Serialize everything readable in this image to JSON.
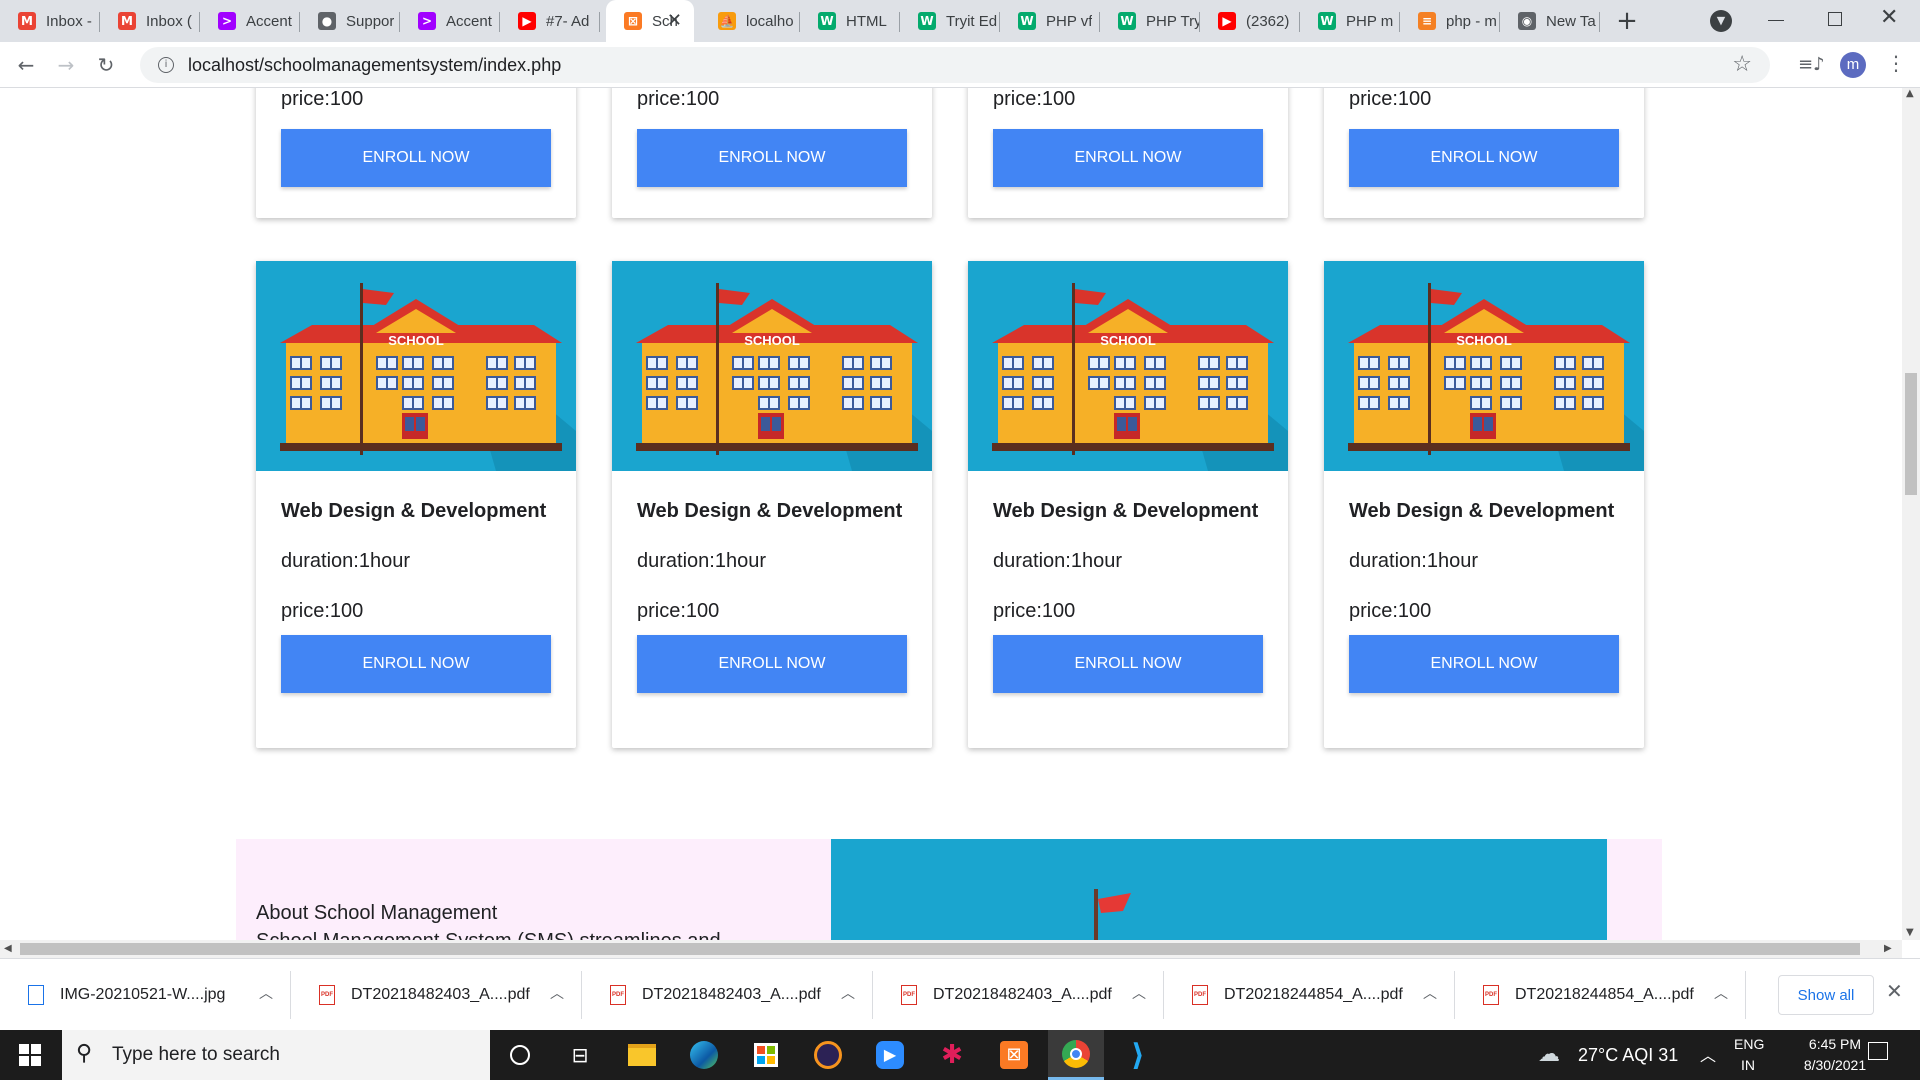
{
  "browser": {
    "tabs": [
      {
        "label": "Inbox -",
        "icon": "gmail-icon",
        "color": "#ea4335",
        "glyph": "M"
      },
      {
        "label": "Inbox (",
        "icon": "gmail-icon",
        "color": "#ea4335",
        "glyph": "M"
      },
      {
        "label": "Accent",
        "icon": "accenture-icon",
        "color": "#a100ff",
        "glyph": ">"
      },
      {
        "label": "Suppor",
        "icon": "globe-icon",
        "color": "#5f6368",
        "glyph": "●"
      },
      {
        "label": "Accent",
        "icon": "accenture-icon",
        "color": "#a100ff",
        "glyph": ">"
      },
      {
        "label": "#7- Ad",
        "icon": "youtube-icon",
        "color": "#ff0000",
        "glyph": "▶"
      },
      {
        "label": "Sch",
        "icon": "xampp-icon",
        "color": "#fb7a24",
        "glyph": "⊠",
        "active": true
      },
      {
        "label": "localho",
        "icon": "phpmyadmin-icon",
        "color": "#f89c0e",
        "glyph": "⛵"
      },
      {
        "label": "HTML",
        "icon": "w3schools-icon",
        "color": "#04aa6d",
        "glyph": "W"
      },
      {
        "label": "Tryit Ed",
        "icon": "w3schools-icon",
        "color": "#04aa6d",
        "glyph": "W"
      },
      {
        "label": "PHP vf",
        "icon": "w3schools-icon",
        "color": "#04aa6d",
        "glyph": "W"
      },
      {
        "label": "PHP Try",
        "icon": "w3schools-icon",
        "color": "#04aa6d",
        "glyph": "W"
      },
      {
        "label": "(2362)",
        "icon": "youtube-icon",
        "color": "#ff0000",
        "glyph": "▶"
      },
      {
        "label": "PHP m",
        "icon": "w3schools-icon",
        "color": "#04aa6d",
        "glyph": "W"
      },
      {
        "label": "php - m",
        "icon": "stackoverflow-icon",
        "color": "#f48024",
        "glyph": "≡"
      },
      {
        "label": "New Ta",
        "icon": "chrome-icon",
        "color": "#5f6368",
        "glyph": "◉"
      }
    ],
    "url": "localhost/schoolmanagementsystem/index.php",
    "profile_initial": "m"
  },
  "courses": {
    "enroll_label": "ENROLL NOW",
    "top_row": [
      {
        "price": "price:100"
      },
      {
        "price": "price:100"
      },
      {
        "price": "price:100"
      },
      {
        "price": "price:100"
      }
    ],
    "grid": [
      {
        "title": "Web Design & Development",
        "duration": "duration:1hour",
        "price": "price:100",
        "image_label": "SCHOOL"
      },
      {
        "title": "Web Design & Development",
        "duration": "duration:1hour",
        "price": "price:100",
        "image_label": "SCHOOL"
      },
      {
        "title": "Web Design & Development",
        "duration": "duration:1hour",
        "price": "price:100",
        "image_label": "SCHOOL"
      },
      {
        "title": "Web Design & Development",
        "duration": "duration:1hour",
        "price": "price:100",
        "image_label": "SCHOOL"
      }
    ]
  },
  "about": {
    "title": "About School Management",
    "text": "School Management System (SMS) streamlines and"
  },
  "downloads": {
    "items": [
      {
        "name": "IMG-20210521-W....jpg",
        "type": "img"
      },
      {
        "name": "DT20218482403_A....pdf",
        "type": "pdf"
      },
      {
        "name": "DT20218482403_A....pdf",
        "type": "pdf"
      },
      {
        "name": "DT20218482403_A....pdf",
        "type": "pdf"
      },
      {
        "name": "DT20218244854_A....pdf",
        "type": "pdf"
      },
      {
        "name": "DT20218244854_A....pdf",
        "type": "pdf"
      }
    ],
    "show_all": "Show all"
  },
  "taskbar": {
    "search_placeholder": "Type here to search",
    "weather": "27°C  AQI 31",
    "lang_top": "ENG",
    "lang_bottom": "IN",
    "time": "6:45 PM",
    "date": "8/30/2021"
  },
  "colors": {
    "accent": "#4285f4",
    "thumb_bg": "#1aa5cf",
    "about_bg": "#fdeefc"
  }
}
